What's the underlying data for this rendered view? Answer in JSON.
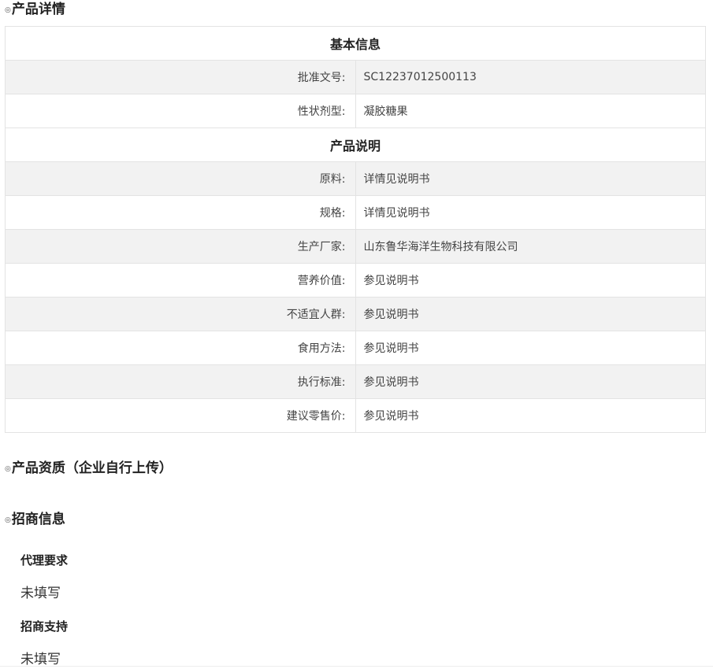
{
  "product_detail": {
    "title": "产品详情",
    "basic_info": {
      "header": "基本信息",
      "rows": [
        {
          "label": "批准文号:",
          "value": "SC12237012500113"
        },
        {
          "label": "性状剂型:",
          "value": "凝胶糖果"
        }
      ]
    },
    "product_desc": {
      "header": "产品说明",
      "rows": [
        {
          "label": "原料:",
          "value": "详情见说明书"
        },
        {
          "label": "规格:",
          "value": "详情见说明书"
        },
        {
          "label": "生产厂家:",
          "value": "山东鲁华海洋生物科技有限公司"
        },
        {
          "label": "营养价值:",
          "value": "参见说明书"
        },
        {
          "label": "不适宜人群:",
          "value": "参见说明书"
        },
        {
          "label": "食用方法:",
          "value": "参见说明书"
        },
        {
          "label": "执行标准:",
          "value": "参见说明书"
        },
        {
          "label": "建议零售价:",
          "value": "参见说明书"
        }
      ]
    }
  },
  "qualification": {
    "title": "产品资质（企业自行上传）"
  },
  "investment": {
    "title": "招商信息",
    "agent_requirement": {
      "label": "代理要求",
      "value": "未填写"
    },
    "support": {
      "label": "招商支持",
      "value": "未填写"
    }
  },
  "bullet_icon": "circle-dot-icon",
  "colors": {
    "shaded_row": "#f2f2f2",
    "border": "#e3e3e3",
    "heading_text": "#222222"
  }
}
